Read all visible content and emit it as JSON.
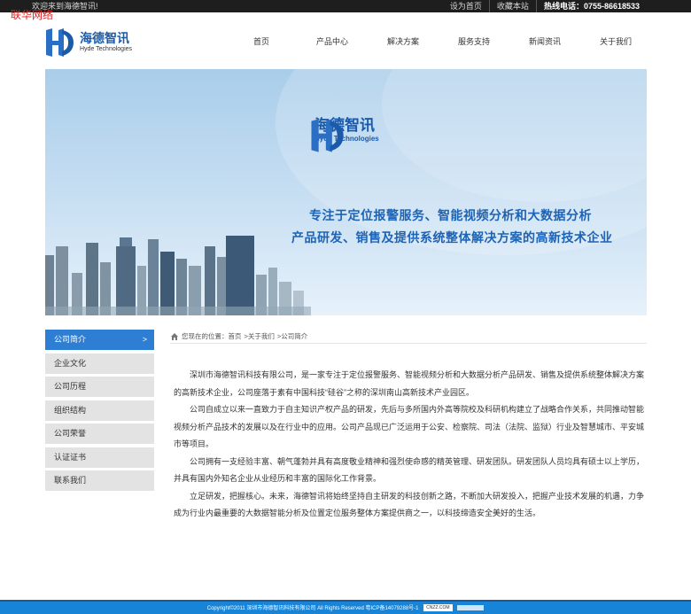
{
  "topbar": {
    "welcome": "欢迎来到海德智讯!",
    "watermark": "联华网络",
    "links": [
      "设为首页",
      "收藏本站"
    ],
    "phone": "热线电话：0755-86618533"
  },
  "brand": {
    "name_cn": "海德智讯",
    "name_en": "Hyde Technologies",
    "accent": "#1a5aa8"
  },
  "nav": {
    "items": [
      "首页",
      "产品中心",
      "解决方案",
      "服务支持",
      "新闻资讯",
      "关于我们"
    ]
  },
  "banner": {
    "slogan_line1": "专注于定位报警服务、智能视频分析和大数据分析",
    "slogan_line2": "产品研发、销售及提供系统整体解决方案的高新技术企业"
  },
  "sidebar": {
    "items": [
      "公司简介",
      "企业文化",
      "公司历程",
      "组织结构",
      "公司荣誉",
      "认证证书",
      "联系我们"
    ],
    "active": "公司简介"
  },
  "breadcrumb": {
    "prefix": "您现在的位置：首页",
    "part2": ">关于我们",
    "part3": ">公司简介"
  },
  "article": {
    "paragraphs": [
      "深圳市海德智讯科技有限公司，是一家专注于定位报警服务、智能视频分析和大数据分析产品研发、销售及提供系统整体解决方案的高新技术企业，公司座落于素有中国科技“硅谷”之称的深圳南山高新技术产业园区。",
      "公司自成立以来一直致力于自主知识产权产品的研发，先后与多所国内外高等院校及科研机构建立了战略合作关系，共同推动智能视频分析产品技术的发展以及在行业中的应用。公司产品现已广泛运用于公安、检察院、司法（法院、监狱）行业及智慧城市、平安城市等项目。",
      "公司拥有一支经验丰富、朝气蓬勃并具有高度敬业精神和强烈使命感的精英管理、研发团队。研发团队人员均具有硕士以上学历，并具有国内外知名企业从业经历和丰富的国际化工作背景。",
      "立足研发，把握核心。未来，海德智讯将始终坚持自主研发的科技创新之路，不断加大研发投入，把握产业技术发展的机遇，力争成为行业内最重要的大数据智能分析及位置定位服务整体方案提供商之一，以科技缔造安全美好的生活。"
    ]
  },
  "footer": {
    "text": "Copyright©2011 深圳市海德智讯科技有限公司 All Rights Reserved 粤ICP备14079288号-1",
    "badge": "CNZZ.COM"
  }
}
